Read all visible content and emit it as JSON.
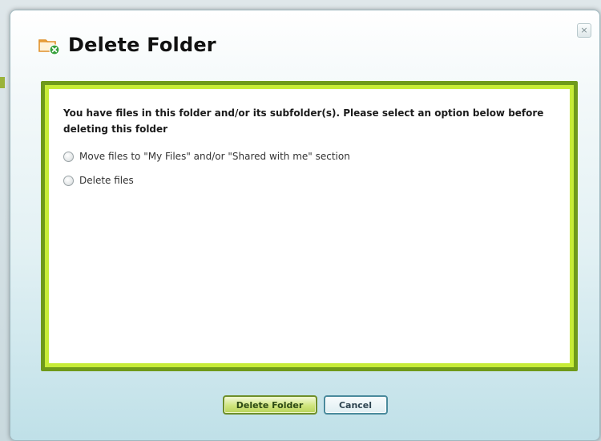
{
  "dialog": {
    "title": "Delete Folder",
    "close_label": "×",
    "message": "You have files in this folder and/or its subfolder(s). Please select an option below before deleting this folder",
    "options": [
      {
        "label": "Move files to \"My Files\" and/or \"Shared with me\" section",
        "selected": false
      },
      {
        "label": "Delete files",
        "selected": false
      }
    ],
    "buttons": {
      "delete_label": "Delete Folder",
      "cancel_label": "Cancel"
    }
  },
  "colors": {
    "frame_dark": "#6f9a1a",
    "frame_light": "#c7ec37",
    "primary_button": "#cfe57e",
    "secondary_button_border": "#4a8a9c"
  },
  "icons": {
    "title_icon": "folder-delete-icon",
    "close_icon": "close-icon"
  }
}
